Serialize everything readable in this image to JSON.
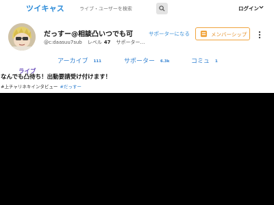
{
  "header": {
    "logo": "ツイキャス",
    "search_placeholder": "ライブ・ユーザーを検索",
    "login_label": "ログイン"
  },
  "profile": {
    "name": "だっすー@相談凸いつでも可",
    "user_id": "@c:daasuu7sub",
    "level_label": "レベル",
    "level_value": "47",
    "supporters_label": "サポーター…",
    "supporter_button": "サポーターになる",
    "membership_button": "メンバーシップ"
  },
  "tabs": [
    {
      "label": "アーカイブ",
      "count": "111"
    },
    {
      "label": "サポーター",
      "count": "6.3k"
    },
    {
      "label": "コミュ",
      "count": "1"
    }
  ],
  "live": {
    "label": "ライブ",
    "title": "なんでも凸待ち！出動要請受け付けます！",
    "subtitle": "#上チャリネキインタビュー",
    "tag": "#だっすー"
  },
  "colors": {
    "brand_blue": "#2a8ad8",
    "membership_orange": "#f0a33b",
    "live_purple": "#6a4dbb"
  }
}
